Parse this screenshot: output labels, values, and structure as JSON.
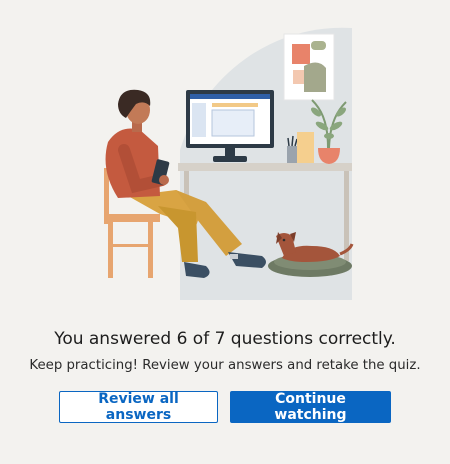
{
  "result": {
    "title": "You answered 6 of 7 questions correctly.",
    "subtitle": "Keep practicing! Review your answers and retake the quiz."
  },
  "actions": {
    "review_label": "Review all answers",
    "continue_label": "Continue watching"
  },
  "colors": {
    "background": "#f3f2ef",
    "accent": "#0a66c2",
    "illustration_backdrop": "#dfe3e5"
  },
  "illustration": {
    "icons": [
      "person-at-desk-illustration",
      "computer-monitor-icon",
      "wall-art-icon",
      "plant-icon",
      "dog-icon",
      "chair-icon"
    ]
  }
}
